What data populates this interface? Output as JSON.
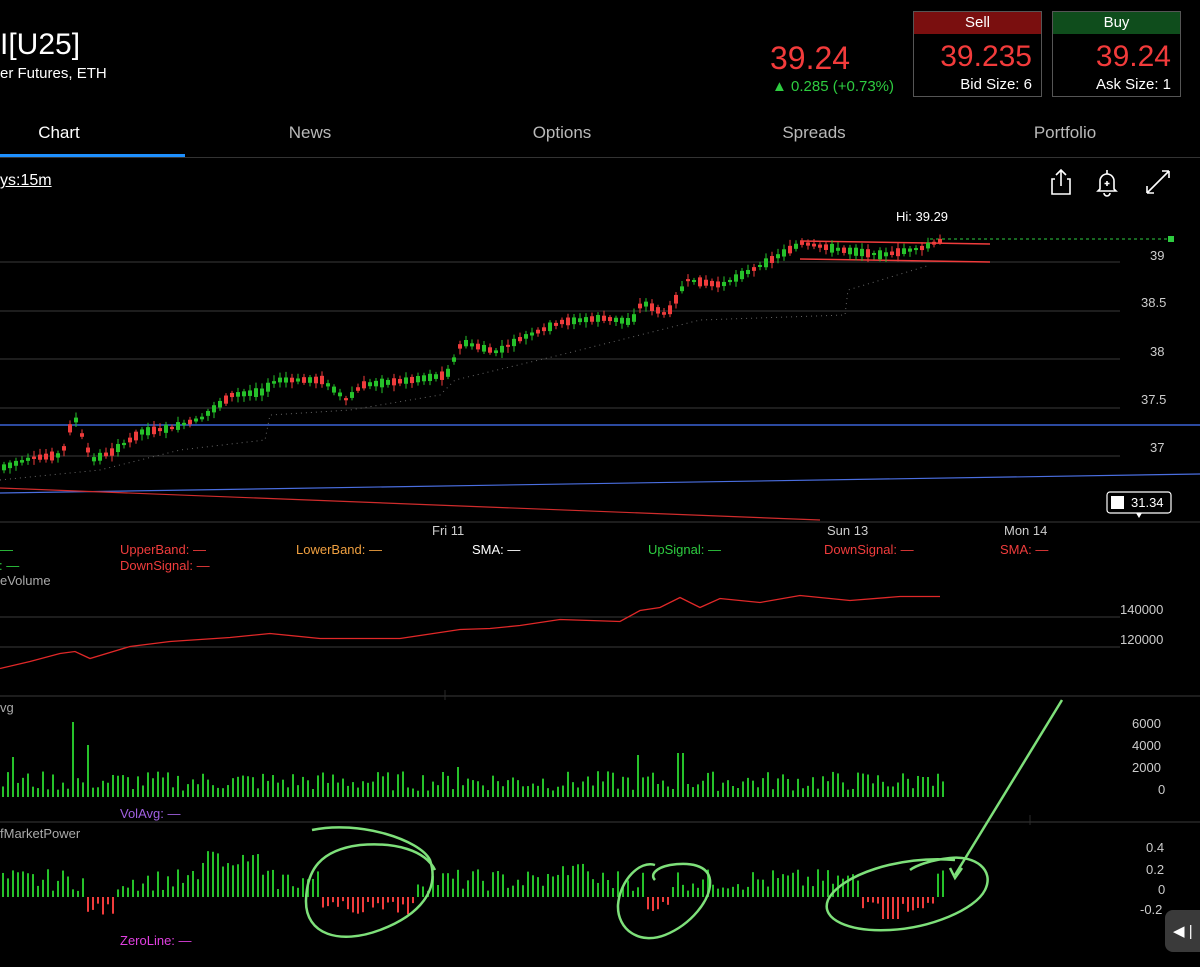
{
  "header": {
    "symbol": "I[U25]",
    "subtitle": "er Futures, ETH",
    "last_price": "39.24",
    "change": "▲ 0.285 (+0.73%)",
    "sell": {
      "label": "Sell",
      "price": "39.235",
      "size": "Bid Size: 6"
    },
    "buy": {
      "label": "Buy",
      "price": "39.24",
      "size": "Ask Size: 1"
    }
  },
  "tabs": [
    {
      "label": "Chart"
    },
    {
      "label": "News"
    },
    {
      "label": "Options"
    },
    {
      "label": "Spreads"
    },
    {
      "label": "Portfolio"
    }
  ],
  "chart": {
    "period": "ys:15m",
    "hi_label": "Hi: 39.29",
    "price_axis": [
      "39",
      "38.5",
      "38",
      "37.5",
      "37"
    ],
    "date_labels": [
      "Fri 11",
      "Sun 13",
      "Mon 14"
    ],
    "crosshair_value": "31.34",
    "icons": [
      "share-icon",
      "alert-bell-icon",
      "expand-icon"
    ],
    "colors": {
      "up": "#26c22a",
      "down": "#f03c3c",
      "trend_blue": "#3b62d6",
      "trend_red": "#d02c2c"
    }
  },
  "legend": {
    "row1": [
      "—",
      "UpperBand: —",
      "LowerBand: —",
      "SMA: —",
      "UpSignal: —",
      "DownSignal: —",
      "SMA: —"
    ],
    "row2_left": "ys: —",
    "row2": "DownSignal: —"
  },
  "volume_panel": {
    "title": "eVolume",
    "axis": [
      "140000",
      "120000"
    ]
  },
  "volavg_panel": {
    "title": "vg",
    "axis": [
      "6000",
      "4000",
      "2000",
      "0"
    ],
    "legend": "VolAvg: —"
  },
  "power_panel": {
    "title": "fMarketPower",
    "axis": [
      "0.4",
      "0.2",
      "0",
      "-0.2"
    ],
    "legend": "ZeroLine: —"
  },
  "nav": {
    "glyph": "◀ |"
  }
}
